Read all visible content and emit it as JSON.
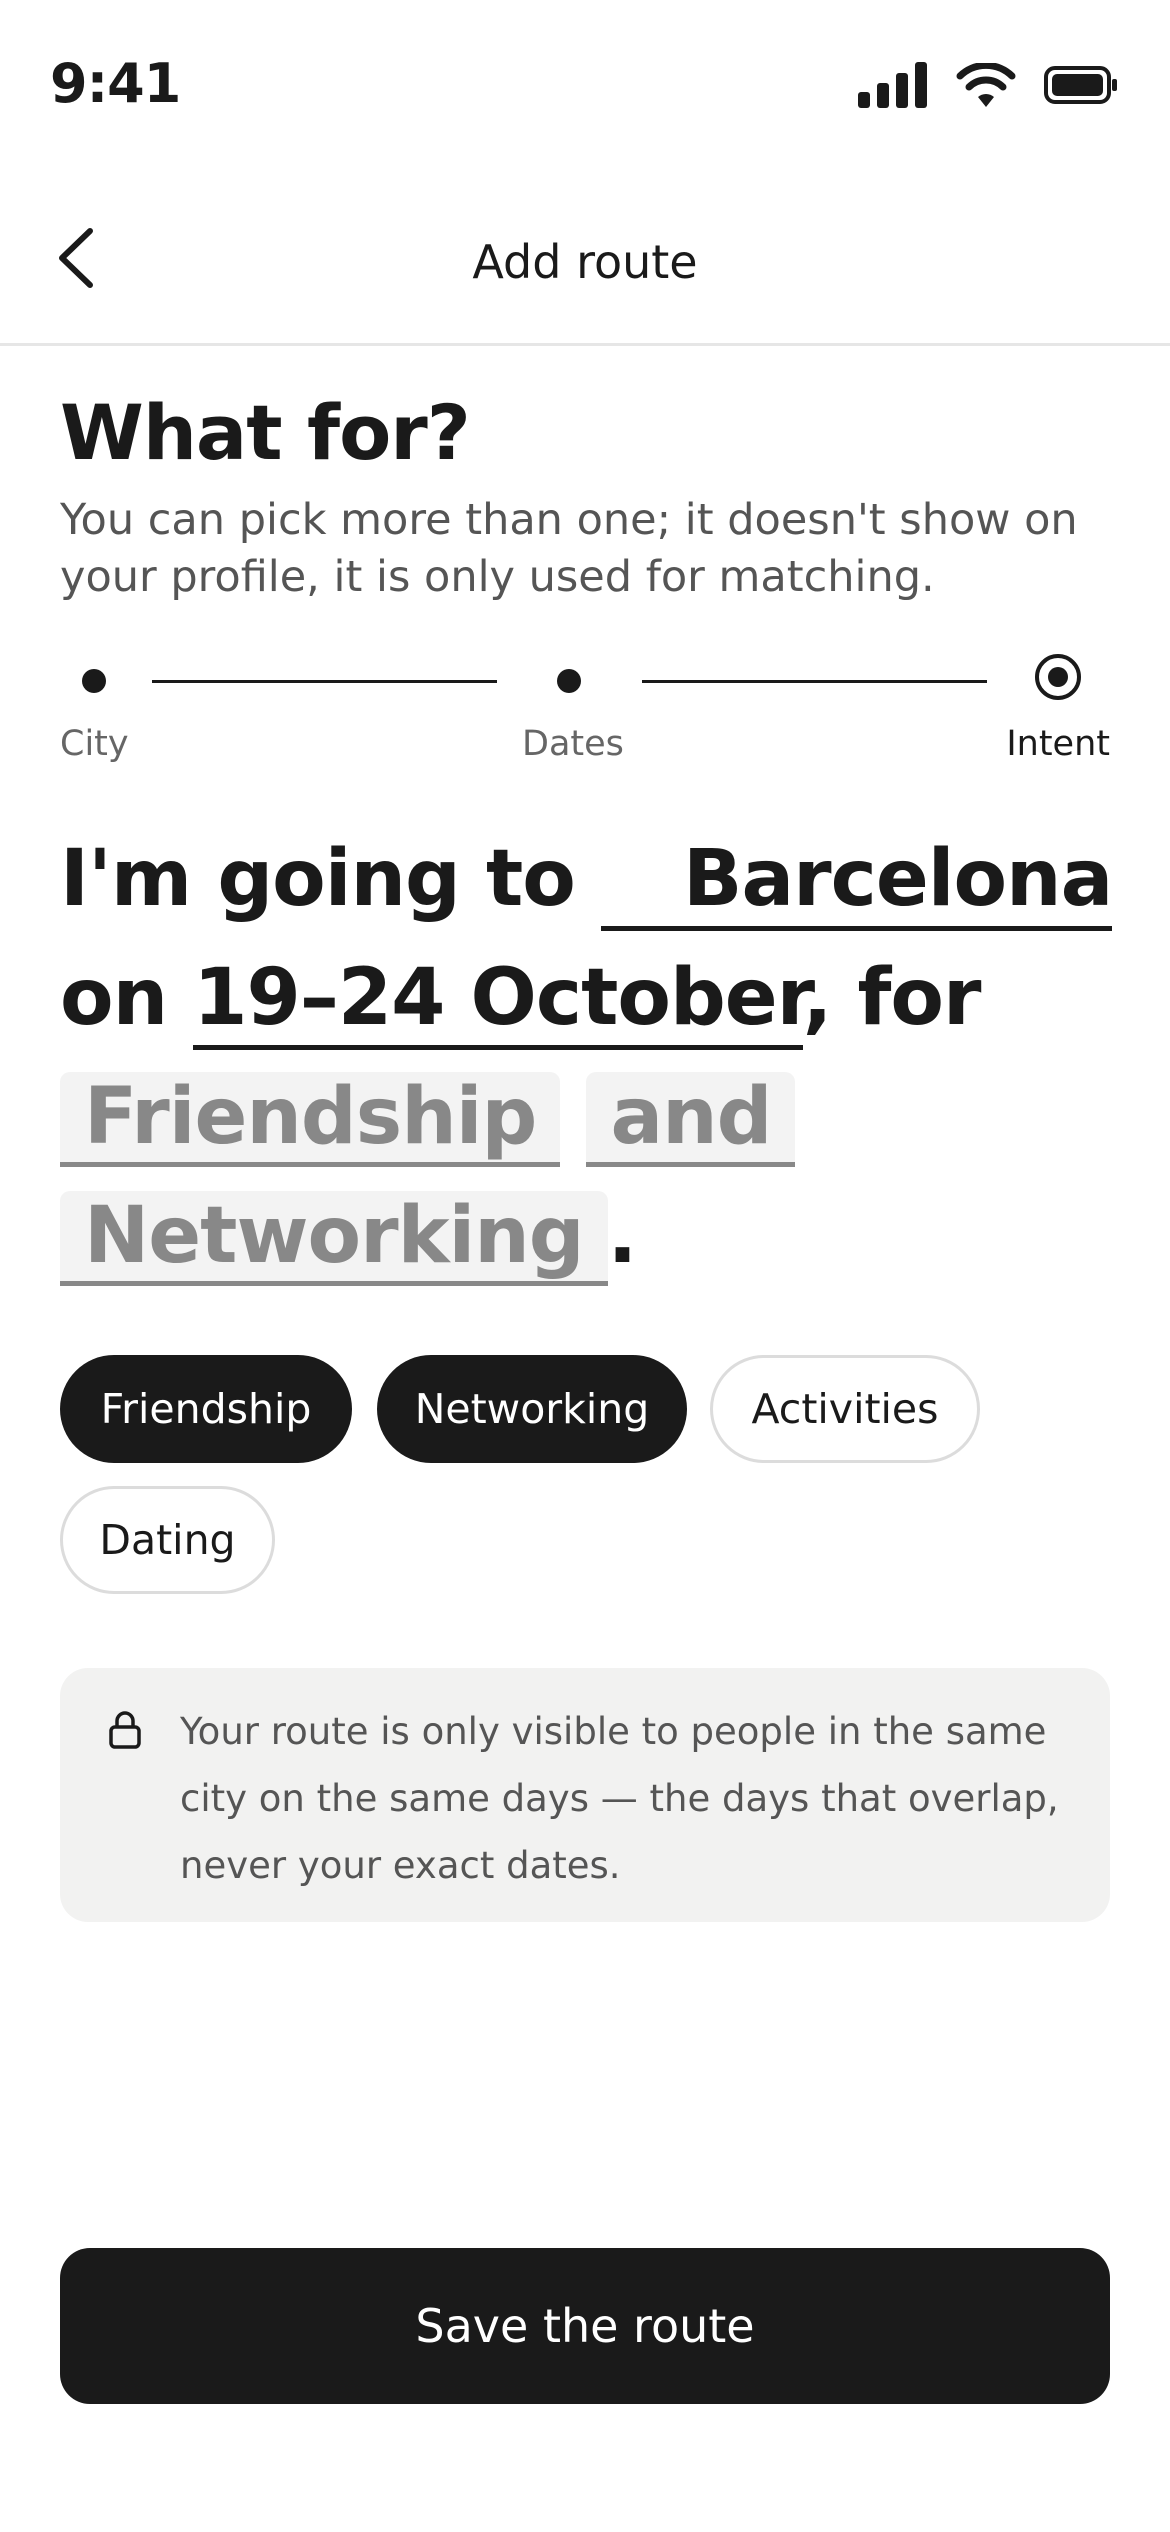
{
  "status_bar": {
    "time": "9:41"
  },
  "nav": {
    "title": "Add route"
  },
  "heading": "What for?",
  "subtitle": "You can pick more than one; it doesn't show on your profile, it is only used for matching.",
  "steps": [
    {
      "label": "City",
      "state": "done"
    },
    {
      "label": "Dates",
      "state": "done"
    },
    {
      "label": "Intent",
      "state": "current"
    }
  ],
  "sentence": {
    "prefix": "I'm going to",
    "city_flag": "spain-flag",
    "city": "Barcelona",
    "on": "on",
    "dates": "19–24 October",
    "for": ", for",
    "intent_1": "Friendship",
    "and": "and",
    "intent_2": "Networking",
    "period": "."
  },
  "chips": [
    {
      "label": "Friendship",
      "selected": true
    },
    {
      "label": "Networking",
      "selected": true
    },
    {
      "label": "Activities",
      "selected": false
    },
    {
      "label": "Dating",
      "selected": false
    }
  ],
  "notice": {
    "icon": "lock-icon",
    "text": "Your route is only visible to people in the same city on the same days — the days that overlap, never your exact dates."
  },
  "save_button": {
    "label": "Save the route"
  },
  "colors": {
    "primary": "#1a1a1a",
    "muted": "#888888",
    "notice_bg": "#f2f2f1",
    "chip_border": "#dcdcdc"
  }
}
